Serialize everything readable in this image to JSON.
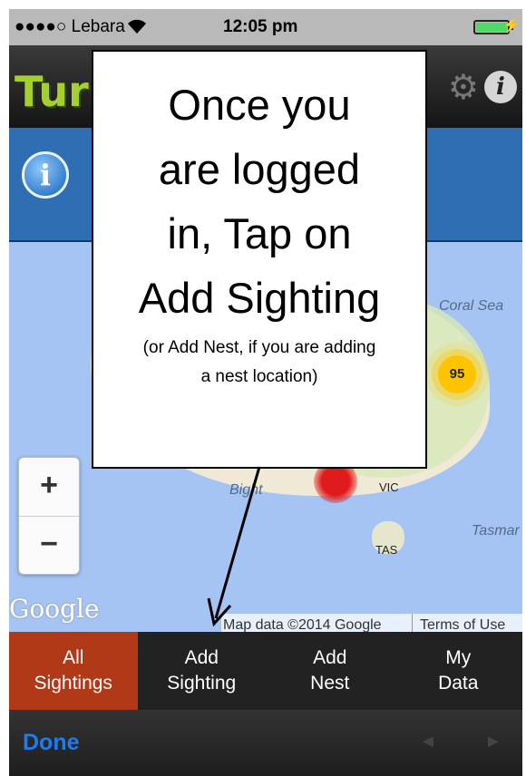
{
  "status_bar": {
    "carrier": "●●●●○ Lebara",
    "wifi_icon": "wifi-icon",
    "time": "12:05 pm",
    "battery_icon": "battery-icon"
  },
  "app_header": {
    "logo_text": "Tur",
    "settings_icon": "gear-icon",
    "info_icon_glyph": "i"
  },
  "info_panel": {
    "info_button_glyph": "i"
  },
  "map": {
    "labels": {
      "coral_sea": "Coral Sea",
      "bight": "Bight",
      "vic": "VIC",
      "tas": "TAS",
      "tasman": "Tasmar"
    },
    "cluster_count": "95",
    "zoom_in": "+",
    "zoom_out": "−",
    "google_logo": "Google",
    "map_data": "Map data ©2014 Google",
    "terms": "Terms of Use"
  },
  "tabs": [
    {
      "line1": "All",
      "line2": "Sightings",
      "active": true
    },
    {
      "line1": "Add",
      "line2": "Sighting",
      "active": false
    },
    {
      "line1": "Add",
      "line2": "Nest",
      "active": false
    },
    {
      "line1": "My",
      "line2": "Data",
      "active": false
    }
  ],
  "toolbar": {
    "done_label": "Done",
    "back_arrow": "◄",
    "forward_arrow": "►"
  },
  "callout": {
    "line1": "Once you",
    "line2": "are logged",
    "line3": "in, Tap on",
    "line4": "Add Sighting",
    "note_line1": "(or Add Nest, if you are adding",
    "note_line2": "a nest location)"
  },
  "colors": {
    "active_tab": "#b03a18",
    "info_panel": "#2f6eb3",
    "done_link": "#1d7cf2",
    "cluster": "#ffc400"
  }
}
